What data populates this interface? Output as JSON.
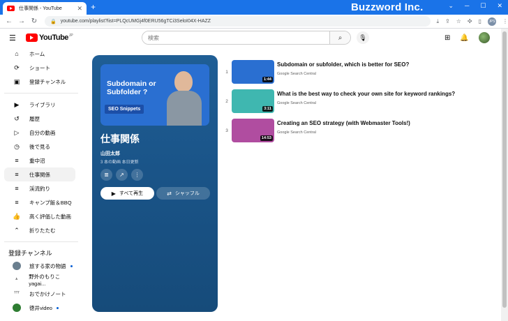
{
  "browser": {
    "tab_title": "仕事関係 - YouTube",
    "url": "youtube.com/playlist?list=PLQcUMGj4f0ERU56gTCi3SeloI04X-HAZZ",
    "brand": "Buzzword Inc.",
    "profile_initials": "JPS"
  },
  "header": {
    "logo_text": "YouTube",
    "logo_suffix": "JP",
    "search_placeholder": "検索"
  },
  "sidebar": {
    "main": [
      {
        "label": "ホーム",
        "icon": "home-icon",
        "glyph": "⌂"
      },
      {
        "label": "ショート",
        "icon": "shorts-icon",
        "glyph": "⟳"
      },
      {
        "label": "登録チャンネル",
        "icon": "subscriptions-icon",
        "glyph": "▣"
      }
    ],
    "library": [
      {
        "label": "ライブラリ",
        "icon": "library-icon",
        "glyph": "▶"
      },
      {
        "label": "履歴",
        "icon": "history-icon",
        "glyph": "↺"
      },
      {
        "label": "自分の動画",
        "icon": "my-videos-icon",
        "glyph": "▷"
      },
      {
        "label": "後で見る",
        "icon": "watch-later-icon",
        "glyph": "◷"
      },
      {
        "label": "重中沼",
        "icon": "playlist-icon",
        "glyph": "≡"
      },
      {
        "label": "仕事関係",
        "icon": "playlist-icon",
        "glyph": "≡",
        "active": true
      },
      {
        "label": "渓流釣り",
        "icon": "playlist-icon",
        "glyph": "≡"
      },
      {
        "label": "キャンプ飯＆BBQ",
        "icon": "playlist-icon",
        "glyph": "≡"
      },
      {
        "label": "高く評価した動画",
        "icon": "like-icon",
        "glyph": "👍"
      },
      {
        "label": "折りたたむ",
        "icon": "chevron-up-icon",
        "glyph": "⌃"
      }
    ],
    "subs_heading": "登録チャンネル",
    "subs": [
      {
        "label": "旅する家の物語",
        "color": "#6b7f8f",
        "dot": true
      },
      {
        "label": "野外のもりこ yagai...",
        "color": "#ffffff",
        "dot": false,
        "glyph": "ᐞ"
      },
      {
        "label": "おでかけノート",
        "color": "#ffffff",
        "dot": false,
        "glyph": "ᵀᵀᵀ"
      },
      {
        "label": "徳井video",
        "color": "#2e7d32",
        "dot": true
      }
    ]
  },
  "playlist": {
    "title": "仕事関係",
    "owner": "山田太郎",
    "meta": "3 本の動画  本日更新",
    "play_all": "すべて再生",
    "shuffle": "シャッフル",
    "thumb_title": "Subdomain or Subfolder ?",
    "thumb_tag": "SEO Snippets"
  },
  "videos": [
    {
      "index": "1",
      "title": "Subdomain or subfolder, which is better for SEO?",
      "channel": "Google Search Central",
      "duration": "1:44",
      "thumb_color": "#2a6fd1",
      "thumb_text": "Subdomain or Subfolder ?"
    },
    {
      "index": "2",
      "title": "What is the best way to check your own site for keyword rankings?",
      "channel": "Google Search Central",
      "duration": "3:11",
      "thumb_color": "#3fb7b0",
      "thumb_text": ""
    },
    {
      "index": "3",
      "title": "Creating an SEO strategy (with Webmaster Tools!)",
      "channel": "Google Search Central",
      "duration": "14:53",
      "thumb_color": "#b04da0",
      "thumb_text": ""
    }
  ]
}
